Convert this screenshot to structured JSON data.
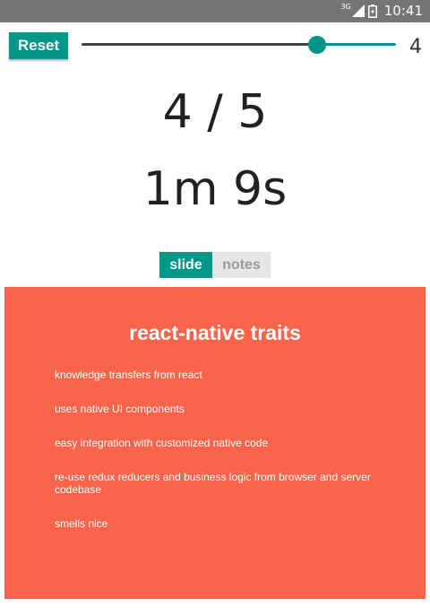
{
  "status_bar": {
    "network": "3G",
    "time": "10:41",
    "icons": [
      "signal-icon",
      "battery-icon"
    ]
  },
  "toolbar": {
    "reset_label": "Reset",
    "slider": {
      "value": 4,
      "min": 1,
      "max": 5,
      "value_label": "4"
    },
    "colors": {
      "accent": "#009688",
      "track_inactive": "#424242"
    }
  },
  "presentation": {
    "slide_counter": "4 / 5",
    "elapsed_time": "1m 9s"
  },
  "view_toggle": {
    "options": [
      "slide",
      "notes"
    ],
    "selected": "slide"
  },
  "slide": {
    "background_color": "#f9644a",
    "title": "react-native traits",
    "bullets": [
      "knowledge transfers from react",
      "uses native UI components",
      "easy integration with customized native code",
      "re-use redux reducers and business logic from browser and server codebase",
      "smells nice"
    ]
  }
}
